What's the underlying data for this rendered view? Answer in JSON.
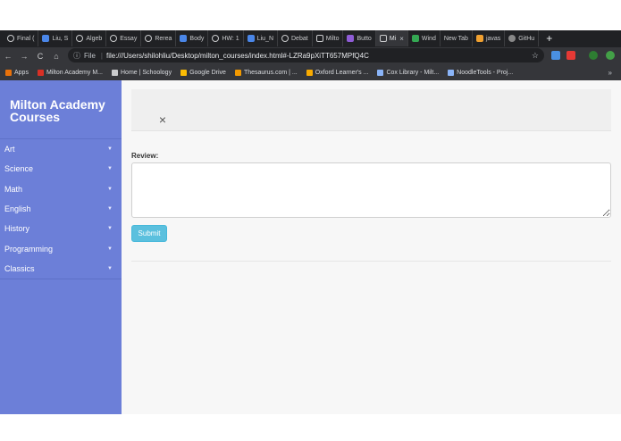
{
  "browser": {
    "tabs": [
      {
        "label": "Final (",
        "icon": "s"
      },
      {
        "label": "Liu, S",
        "icon": "doc"
      },
      {
        "label": "Algeb",
        "icon": "s"
      },
      {
        "label": "Essay",
        "icon": "s"
      },
      {
        "label": "Rerea",
        "icon": "s"
      },
      {
        "label": "Body",
        "icon": "doc"
      },
      {
        "label": "HW: 1",
        "icon": "s"
      },
      {
        "label": "Liu_N",
        "icon": "doc"
      },
      {
        "label": "Debat",
        "icon": "s"
      },
      {
        "label": "Milto",
        "icon": "page"
      },
      {
        "label": "Butto",
        "icon": "b"
      },
      {
        "label": "Mi",
        "icon": "page",
        "active": true
      },
      {
        "label": "Wind",
        "icon": "grn"
      },
      {
        "label": "New Tab",
        "icon": "none"
      },
      {
        "label": "javas",
        "icon": "js"
      },
      {
        "label": "GitHu",
        "icon": "gh"
      }
    ],
    "new_tab_symbol": "+",
    "tab_close_symbol": "×",
    "nav": {
      "back": "←",
      "forward": "→",
      "reload": "C",
      "home": "⌂"
    },
    "omnibox": {
      "scheme_label": "File",
      "url": "file:///Users/shilohliu/Desktop/milton_courses/index.html#-LZRa9pXiTT657MPfQ4C",
      "star": "☆"
    },
    "bookmarks": [
      {
        "label": "Apps",
        "color": "#e8710a"
      },
      {
        "label": "Milton Academy M...",
        "color": "#d93025"
      },
      {
        "label": "Home | Schoology",
        "color": "#c9cacc"
      },
      {
        "label": "Google Drive",
        "color": "#fbbc04"
      },
      {
        "label": "Thesaurus.com | ...",
        "color": "#f29900"
      },
      {
        "label": "Oxford Learner's ...",
        "color": "#f9ab00"
      },
      {
        "label": "Cox Library - Milt...",
        "color": "#8ab4f8"
      },
      {
        "label": "NoodleTools - Proj...",
        "color": "#8ab4f8"
      }
    ],
    "bookmarks_more": "»"
  },
  "sidebar": {
    "brand": "Milton Academy Courses",
    "items": [
      {
        "label": "Art"
      },
      {
        "label": "Science"
      },
      {
        "label": "Math"
      },
      {
        "label": "English"
      },
      {
        "label": "History"
      },
      {
        "label": "Programming"
      },
      {
        "label": "Classics"
      }
    ],
    "chevron": "▼"
  },
  "main": {
    "close_symbol": "×",
    "review_label": "Review:",
    "review_value": "",
    "submit_label": "Submit"
  },
  "colors": {
    "sidebar": "#6c7fd8",
    "submit": "#5bc0de"
  }
}
